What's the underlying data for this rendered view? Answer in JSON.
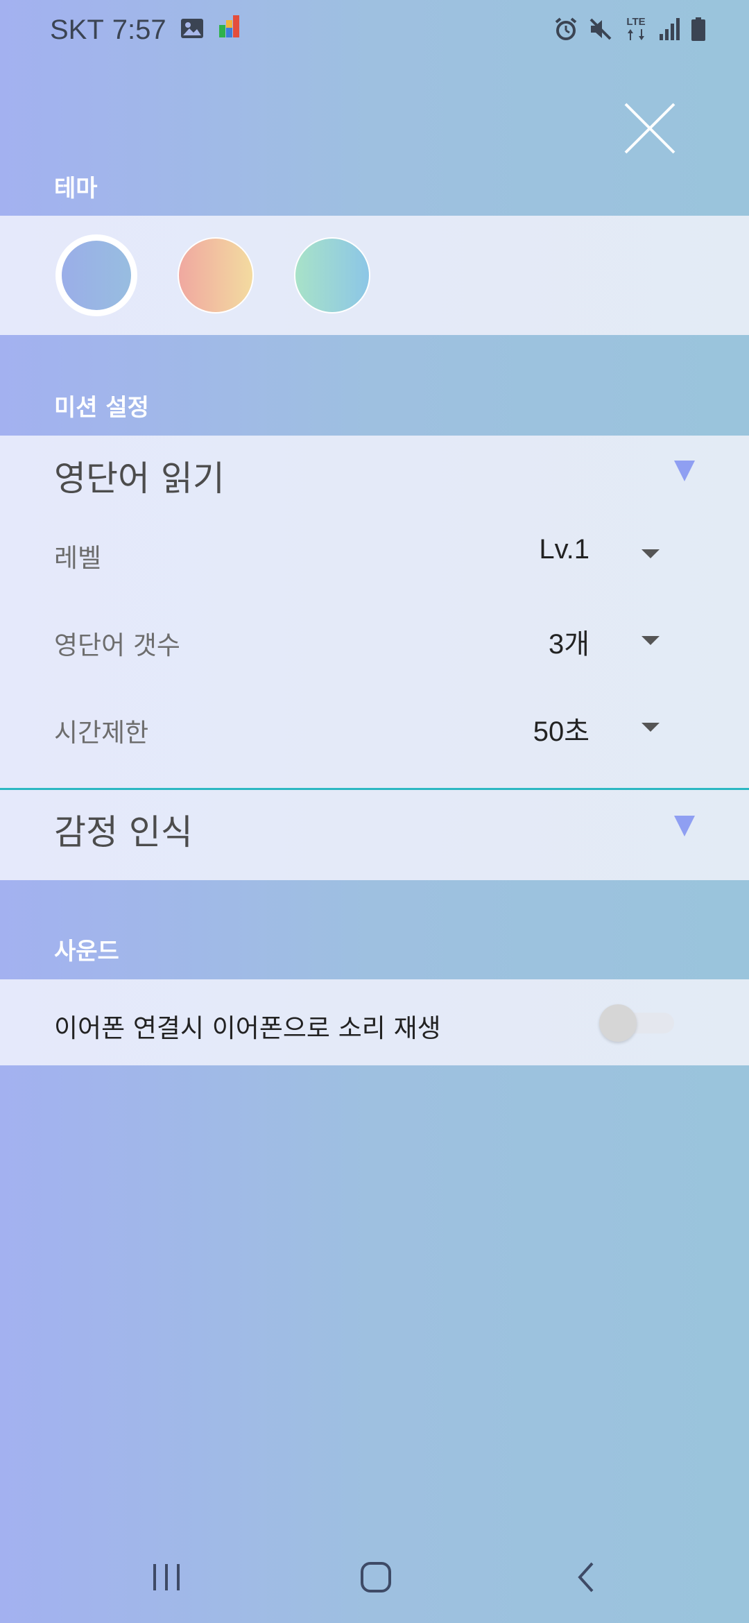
{
  "status_bar": {
    "carrier": "SKT",
    "time": "7:57",
    "network": "LTE",
    "icons_left": [
      "gallery-icon",
      "app-notification-icon"
    ],
    "icons_right": [
      "alarm-icon",
      "mute-icon",
      "lte-icon",
      "signal-icon",
      "battery-icon"
    ]
  },
  "sections": {
    "theme": {
      "label": "테마",
      "swatches": [
        {
          "name": "blue",
          "colors": [
            "#9aaee8",
            "#98bde0"
          ],
          "selected": true
        },
        {
          "name": "peach",
          "colors": [
            "#f0a8a0",
            "#f3dba0"
          ],
          "selected": false
        },
        {
          "name": "mint",
          "colors": [
            "#a8e2c8",
            "#8cc6e6"
          ],
          "selected": false
        }
      ]
    },
    "mission": {
      "label": "미션 설정",
      "groups": [
        {
          "title": "영단어 읽기",
          "rows": [
            {
              "label": "레벨",
              "value": "Lv.1"
            },
            {
              "label": "영단어 갯수",
              "value": "3개"
            },
            {
              "label": "시간제한",
              "value": "50초"
            }
          ]
        },
        {
          "title": "감정 인식"
        }
      ]
    },
    "sound": {
      "label": "사운드",
      "earphone_label": "이어폰 연결시 이어폰으로 소리 재생",
      "earphone_toggle": false
    }
  },
  "colors": {
    "accent_arrow": "#8f9ff2",
    "divider": "#2bb7c2",
    "section_text": "#ffffff"
  }
}
